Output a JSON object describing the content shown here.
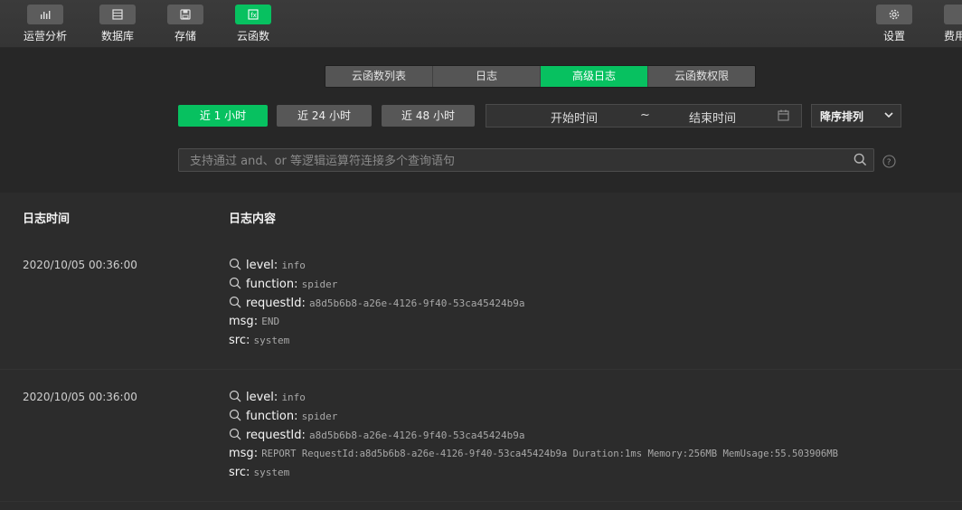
{
  "toolbar": {
    "items": [
      {
        "label": "运营分析",
        "icon": "bar-chart-icon"
      },
      {
        "label": "数据库",
        "icon": "database-icon"
      },
      {
        "label": "存储",
        "icon": "storage-icon"
      },
      {
        "label": "云函数",
        "icon": "function-icon"
      }
    ],
    "right": [
      {
        "label": "设置",
        "icon": "gear-icon"
      },
      {
        "label": "费用",
        "icon": "cost-icon"
      }
    ]
  },
  "tabs": [
    "云函数列表",
    "日志",
    "高级日志",
    "云函数权限"
  ],
  "active_tab": "高级日志",
  "filters": {
    "btn_1h": "近 1 小时",
    "btn_24h": "近 24 小时",
    "btn_48h": "近 48 小时",
    "start_time": "开始时间",
    "range_sep": "~",
    "end_time": "结束时间",
    "sort": "降序排列"
  },
  "search": {
    "placeholder": "支持通过 and、or 等逻辑运算符连接多个查询语句"
  },
  "table": {
    "col_time": "日志时间",
    "col_content": "日志内容"
  },
  "logs": [
    {
      "time": "2020/10/05 00:36:00",
      "fields": [
        {
          "key": "level",
          "value": "info"
        },
        {
          "key": "function",
          "value": "spider"
        },
        {
          "key": "requestId",
          "value": "a8d5b6b8-a26e-4126-9f40-53ca45424b9a"
        },
        {
          "key": "msg",
          "value": "END"
        },
        {
          "key": "src",
          "value": "system"
        }
      ]
    },
    {
      "time": "2020/10/05 00:36:00",
      "fields": [
        {
          "key": "level",
          "value": "info"
        },
        {
          "key": "function",
          "value": "spider"
        },
        {
          "key": "requestId",
          "value": "a8d5b6b8-a26e-4126-9f40-53ca45424b9a"
        },
        {
          "key": "msg",
          "value": "REPORT RequestId:a8d5b6b8-a26e-4126-9f40-53ca45424b9a Duration:1ms Memory:256MB MemUsage:55.503906MB"
        },
        {
          "key": "src",
          "value": "system"
        }
      ]
    }
  ],
  "colors": {
    "accent": "#07c160",
    "background": "#272727",
    "toolbar": "#383838"
  }
}
